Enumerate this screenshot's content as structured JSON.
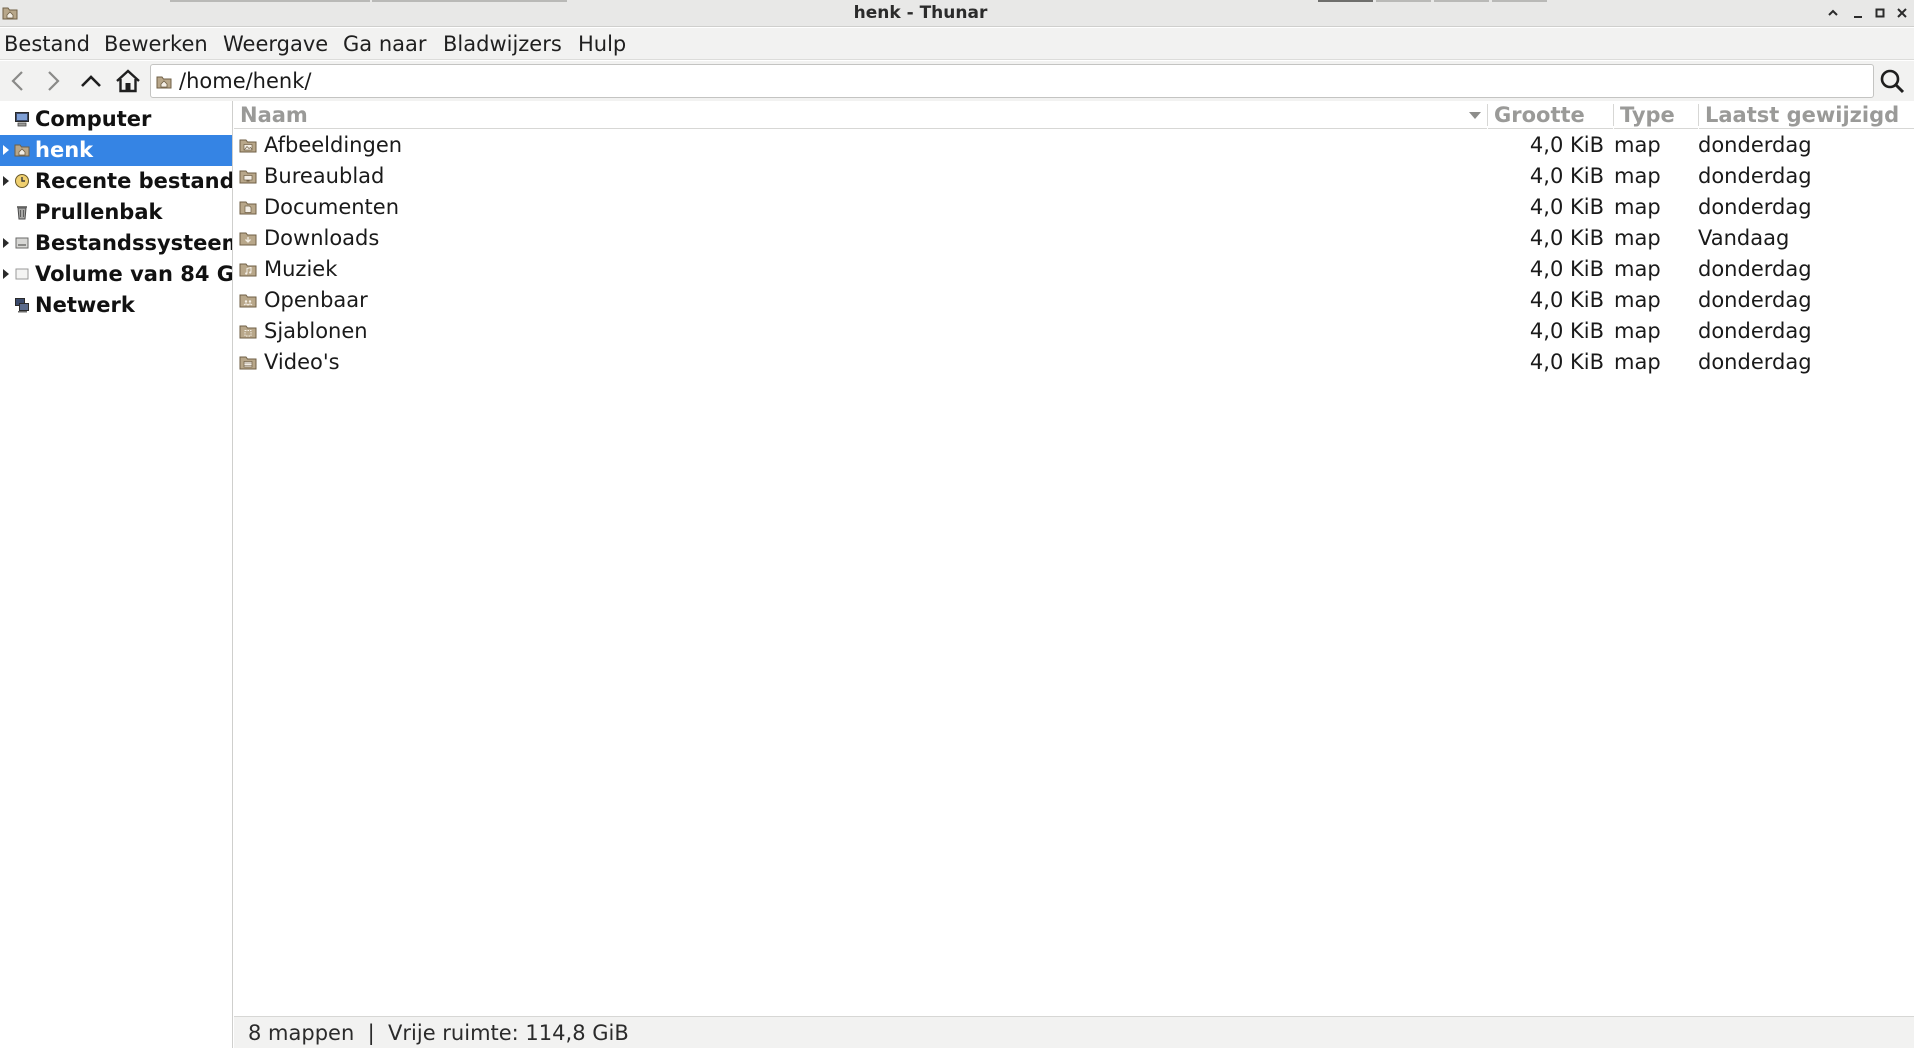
{
  "window": {
    "title": "henk - Thunar"
  },
  "menubar": {
    "items": [
      {
        "label": "Bestand"
      },
      {
        "label": "Bewerken"
      },
      {
        "label": "Weergave"
      },
      {
        "label": "Ga naar"
      },
      {
        "label": "Bladwijzers"
      },
      {
        "label": "Hulp"
      }
    ]
  },
  "toolbar": {
    "location": "/home/henk/",
    "icons": [
      "back-icon",
      "forward-icon",
      "parent-folder-icon",
      "home-icon",
      "search-icon"
    ]
  },
  "sidebar": {
    "items": [
      {
        "label": "Computer",
        "icon": "computer-icon"
      },
      {
        "label": "henk",
        "icon": "home-folder-icon",
        "selected": true
      },
      {
        "label": "Recente bestand",
        "icon": "recent-icon"
      },
      {
        "label": "Prullenbak",
        "icon": "trash-icon"
      },
      {
        "label": "Bestandssysteem",
        "icon": "filesystem-icon"
      },
      {
        "label": "Volume van 84 G",
        "icon": "drive-icon"
      },
      {
        "label": "Netwerk",
        "icon": "network-icon"
      }
    ]
  },
  "filelist": {
    "columns": {
      "name": "Naam",
      "size": "Grootte",
      "type": "Type",
      "modified": "Laatst gewijzigd"
    },
    "rows": [
      {
        "name": "Afbeeldingen",
        "size": "4,0 KiB",
        "type": "map",
        "modified": "donderdag"
      },
      {
        "name": "Bureaublad",
        "size": "4,0 KiB",
        "type": "map",
        "modified": "donderdag"
      },
      {
        "name": "Documenten",
        "size": "4,0 KiB",
        "type": "map",
        "modified": "donderdag"
      },
      {
        "name": "Downloads",
        "size": "4,0 KiB",
        "type": "map",
        "modified": "Vandaag"
      },
      {
        "name": "Muziek",
        "size": "4,0 KiB",
        "type": "map",
        "modified": "donderdag"
      },
      {
        "name": "Openbaar",
        "size": "4,0 KiB",
        "type": "map",
        "modified": "donderdag"
      },
      {
        "name": "Sjablonen",
        "size": "4,0 KiB",
        "type": "map",
        "modified": "donderdag"
      },
      {
        "name": "Video's",
        "size": "4,0 KiB",
        "type": "map",
        "modified": "donderdag"
      }
    ]
  },
  "statusbar": {
    "text": "8 mappen  |  Vrije ruimte: 114,8 GiB"
  },
  "colors": {
    "selection": "#3584e4",
    "folder": "#9c8a6e",
    "chrome": "#f2f2f1"
  }
}
